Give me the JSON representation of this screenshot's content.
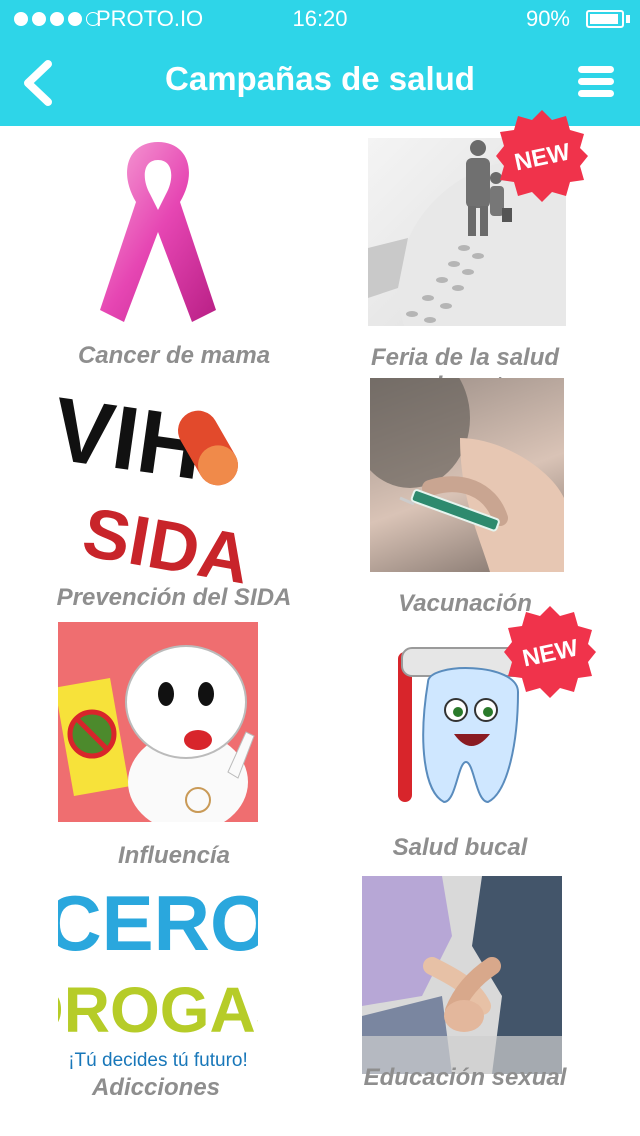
{
  "status_bar": {
    "carrier": "PROTO.IO",
    "time": "16:20",
    "battery": "90%"
  },
  "header": {
    "title": "Campañas de salud",
    "back_icon": "chevron-left-icon",
    "menu_icon": "hamburger-menu-icon"
  },
  "badge_text": "NEW",
  "campaigns": [
    {
      "label": "Cancer de mama",
      "icon": "pink-ribbon-icon",
      "is_new": false
    },
    {
      "label": "Feria de la salud migrante",
      "icon": "migrant-family-icon",
      "is_new": true
    },
    {
      "label": "Prevención del SIDA",
      "icon": "vih-sida-icon",
      "is_new": false
    },
    {
      "label": "Vacunación",
      "icon": "vaccine-syringe-icon",
      "is_new": false
    },
    {
      "label": "Influencía",
      "icon": "flu-mascot-icon",
      "is_new": false
    },
    {
      "label": "Salud bucal",
      "icon": "tooth-brush-icon",
      "is_new": true
    },
    {
      "label": "Adicciones",
      "icon": "cero-drogas-logo",
      "is_new": false,
      "logo_text": [
        "CERO",
        "DROGAS",
        "¡Tú decides tú futuro!"
      ]
    },
    {
      "label": "Educación sexual",
      "icon": "holding-hands-icon",
      "is_new": false
    }
  ],
  "colors": {
    "header": "#2ed5e8",
    "label": "#8e8e8e",
    "badge": "#f0334b"
  }
}
